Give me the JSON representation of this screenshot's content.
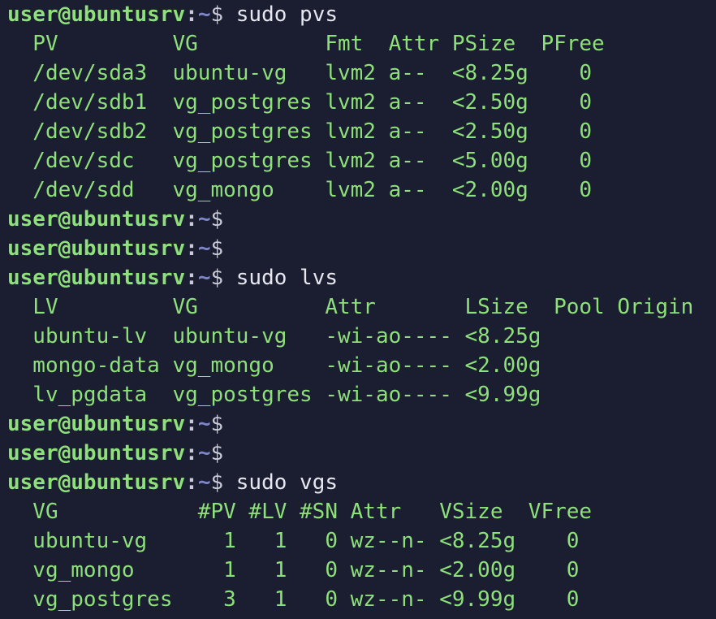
{
  "colors": {
    "background": "#1b1d30",
    "prompt_user": "#8ee07a",
    "prompt_path": "#7e86c9",
    "command": "#e6e7ef",
    "output": "#8ee07a"
  },
  "prompt": {
    "user_host": "user@ubuntusrv",
    "colon": ":",
    "path": "~",
    "symbol": "$"
  },
  "lines": [
    {
      "type": "prompt",
      "cmd": " sudo pvs"
    },
    {
      "type": "out",
      "text": "  PV         VG          Fmt  Attr PSize  PFree"
    },
    {
      "type": "out",
      "text": "  /dev/sda3  ubuntu-vg   lvm2 a--  <8.25g    0"
    },
    {
      "type": "out",
      "text": "  /dev/sdb1  vg_postgres lvm2 a--  <2.50g    0"
    },
    {
      "type": "out",
      "text": "  /dev/sdb2  vg_postgres lvm2 a--  <2.50g    0"
    },
    {
      "type": "out",
      "text": "  /dev/sdc   vg_postgres lvm2 a--  <5.00g    0"
    },
    {
      "type": "out",
      "text": "  /dev/sdd   vg_mongo    lvm2 a--  <2.00g    0"
    },
    {
      "type": "prompt",
      "cmd": ""
    },
    {
      "type": "prompt",
      "cmd": ""
    },
    {
      "type": "prompt",
      "cmd": " sudo lvs"
    },
    {
      "type": "out",
      "text": "  LV         VG          Attr       LSize  Pool Origin"
    },
    {
      "type": "out",
      "text": "  ubuntu-lv  ubuntu-vg   -wi-ao---- <8.25g"
    },
    {
      "type": "out",
      "text": "  mongo-data vg_mongo    -wi-ao---- <2.00g"
    },
    {
      "type": "out",
      "text": "  lv_pgdata  vg_postgres -wi-ao---- <9.99g"
    },
    {
      "type": "prompt",
      "cmd": ""
    },
    {
      "type": "prompt",
      "cmd": ""
    },
    {
      "type": "prompt",
      "cmd": " sudo vgs"
    },
    {
      "type": "out",
      "text": "  VG           #PV #LV #SN Attr   VSize  VFree"
    },
    {
      "type": "out",
      "text": "  ubuntu-vg      1   1   0 wz--n- <8.25g    0"
    },
    {
      "type": "out",
      "text": "  vg_mongo       1   1   0 wz--n- <2.00g    0"
    },
    {
      "type": "out",
      "text": "  vg_postgres    3   1   0 wz--n- <9.99g    0"
    }
  ]
}
